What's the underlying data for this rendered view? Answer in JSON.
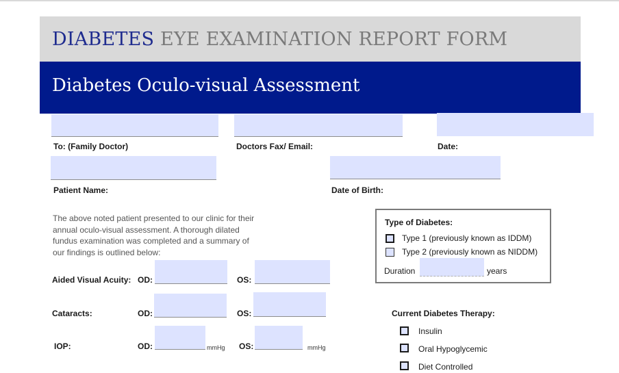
{
  "header": {
    "title_accent": "DIABETES",
    "title_rest": " EYE EXAMINATION REPORT FORM",
    "banner": "Diabetes Oculo-visual Assessment"
  },
  "fields": {
    "to_label": "To: (Family Doctor)",
    "fax_label": "Doctors Fax/ Email:",
    "date_label": "Date:",
    "patient_label": "Patient Name:",
    "dob_label": "Date of Birth:"
  },
  "intro": {
    "lines": [
      "The above noted patient presented to our clinic for their",
      "annual oculo-visual assessment. A thorough dilated",
      "fundus examination was completed and a summary of",
      "our findings is outlined below:"
    ]
  },
  "diabetes_type": {
    "title": "Type of Diabetes:",
    "type1": "Type 1 (previously known as IDDM)",
    "type2": "Type 2 (previously known as NIDDM)",
    "duration_label": "Duration",
    "years_label": "years"
  },
  "exam": {
    "visual_acuity_label": "Aided Visual Acuity:",
    "cataracts_label": "Cataracts:",
    "iop_label": "IOP:",
    "od": "OD:",
    "os": "OS:",
    "unit": "mmHg"
  },
  "therapy": {
    "title": "Current Diabetes Therapy:",
    "options": [
      "Insulin",
      "Oral Hypoglycemic",
      "Diet Controlled"
    ]
  }
}
